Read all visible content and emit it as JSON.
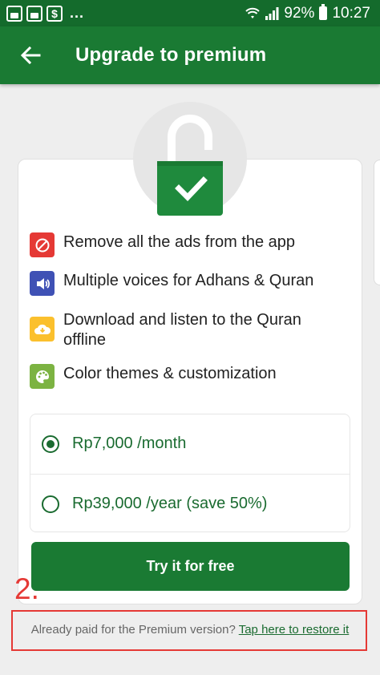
{
  "status_bar": {
    "dots": "...",
    "battery": "92%",
    "time": "10:27"
  },
  "app_bar": {
    "title": "Upgrade to premium"
  },
  "features": [
    {
      "label": "Remove all the ads from the app",
      "icon": "no-ads-icon",
      "color": "#e53935"
    },
    {
      "label": "Multiple voices for Adhans & Quran",
      "icon": "speaker-icon",
      "color": "#3f51b5"
    },
    {
      "label": "Download and listen to the Quran offline",
      "icon": "cloud-download-icon",
      "color": "#fbc02d"
    },
    {
      "label": "Color themes & customization",
      "icon": "palette-icon",
      "color": "#7cb342"
    }
  ],
  "plans": [
    {
      "label": "Rp7,000 /month",
      "selected": true
    },
    {
      "label": "Rp39,000 /year (save 50%)",
      "selected": false
    }
  ],
  "cta": {
    "label": "Try it for free"
  },
  "annotation": {
    "number": "2."
  },
  "restore": {
    "prefix": "Already paid for the Premium version?",
    "link": "Tap here to restore it"
  },
  "colors": {
    "primary": "#1a7a33",
    "status_bar": "#146b2c",
    "annotation": "#e53935"
  }
}
